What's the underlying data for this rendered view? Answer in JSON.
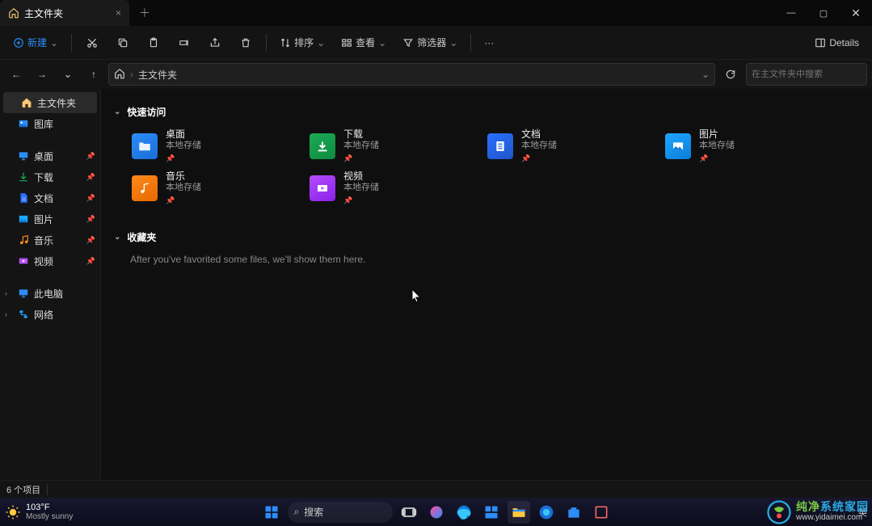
{
  "titlebar": {
    "tab": {
      "title": "主文件夹",
      "close": "×"
    },
    "newtab": "＋"
  },
  "toolbar": {
    "new": "新建",
    "sort": "排序",
    "view": "查看",
    "filter": "筛选器",
    "more": "···",
    "details": "Details"
  },
  "nav": {
    "back": "←",
    "fwd": "→",
    "up": "↑",
    "crumb": "主文件夹",
    "dropdown": "⌄",
    "refresh": "⟳"
  },
  "search": {
    "placeholder": "在主文件夹中搜索",
    "icon": "⌕"
  },
  "sidebar": {
    "primary": [
      {
        "label": "主文件夹",
        "active": true
      },
      {
        "label": "图库"
      }
    ],
    "pinned": [
      {
        "label": "桌面"
      },
      {
        "label": "下载"
      },
      {
        "label": "文档"
      },
      {
        "label": "图片"
      },
      {
        "label": "音乐"
      },
      {
        "label": "视频"
      }
    ],
    "tree": [
      {
        "label": "此电脑"
      },
      {
        "label": "网络"
      }
    ]
  },
  "main": {
    "quick": {
      "header": "快速访问",
      "items": [
        {
          "name": "桌面",
          "sub": "本地存储"
        },
        {
          "name": "下载",
          "sub": "本地存储"
        },
        {
          "name": "文档",
          "sub": "本地存储"
        },
        {
          "name": "图片",
          "sub": "本地存储"
        },
        {
          "name": "音乐",
          "sub": "本地存储"
        },
        {
          "name": "视频",
          "sub": "本地存储"
        }
      ]
    },
    "fav": {
      "header": "收藏夹",
      "empty": "After you've favorited some files, we'll show them here."
    }
  },
  "status": {
    "count": "6 个项目"
  },
  "taskbar": {
    "weather": {
      "temp": "103°F",
      "desc": "Mostly sunny"
    },
    "search": "搜索",
    "tray": {
      "caret": "^",
      "lang": "英"
    }
  },
  "watermark": {
    "cn1": "纯净",
    "cn2": "系统家园",
    "url": "www.yidaimei.com"
  }
}
